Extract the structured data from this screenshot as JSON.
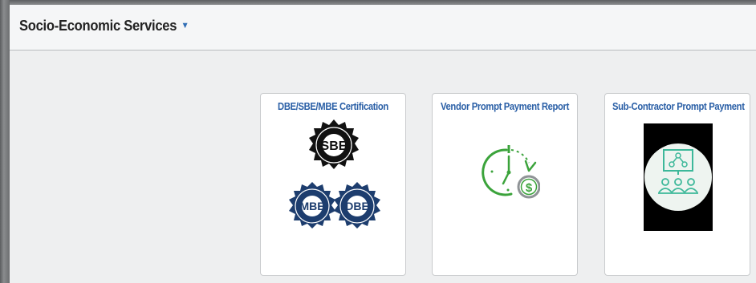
{
  "header": {
    "title": "Socio-Economic Services",
    "dropdown_icon": "caret-down-icon"
  },
  "tiles": [
    {
      "title": "DBE/SBE/MBE Certification",
      "icon": "certification-seals-icon",
      "seal_labels": [
        "SBE",
        "MBE",
        "DBE"
      ]
    },
    {
      "title": "Vendor Prompt Payment Report",
      "icon": "clock-payment-icon",
      "currency_symbol": "$"
    },
    {
      "title": "Sub-Contractor Prompt Payment",
      "icon": "team-presentation-icon"
    }
  ],
  "colors": {
    "title_blue": "#2a5fa6",
    "caret_blue": "#2f6db5",
    "green": "#3ba33b",
    "teal": "#3db89a"
  }
}
